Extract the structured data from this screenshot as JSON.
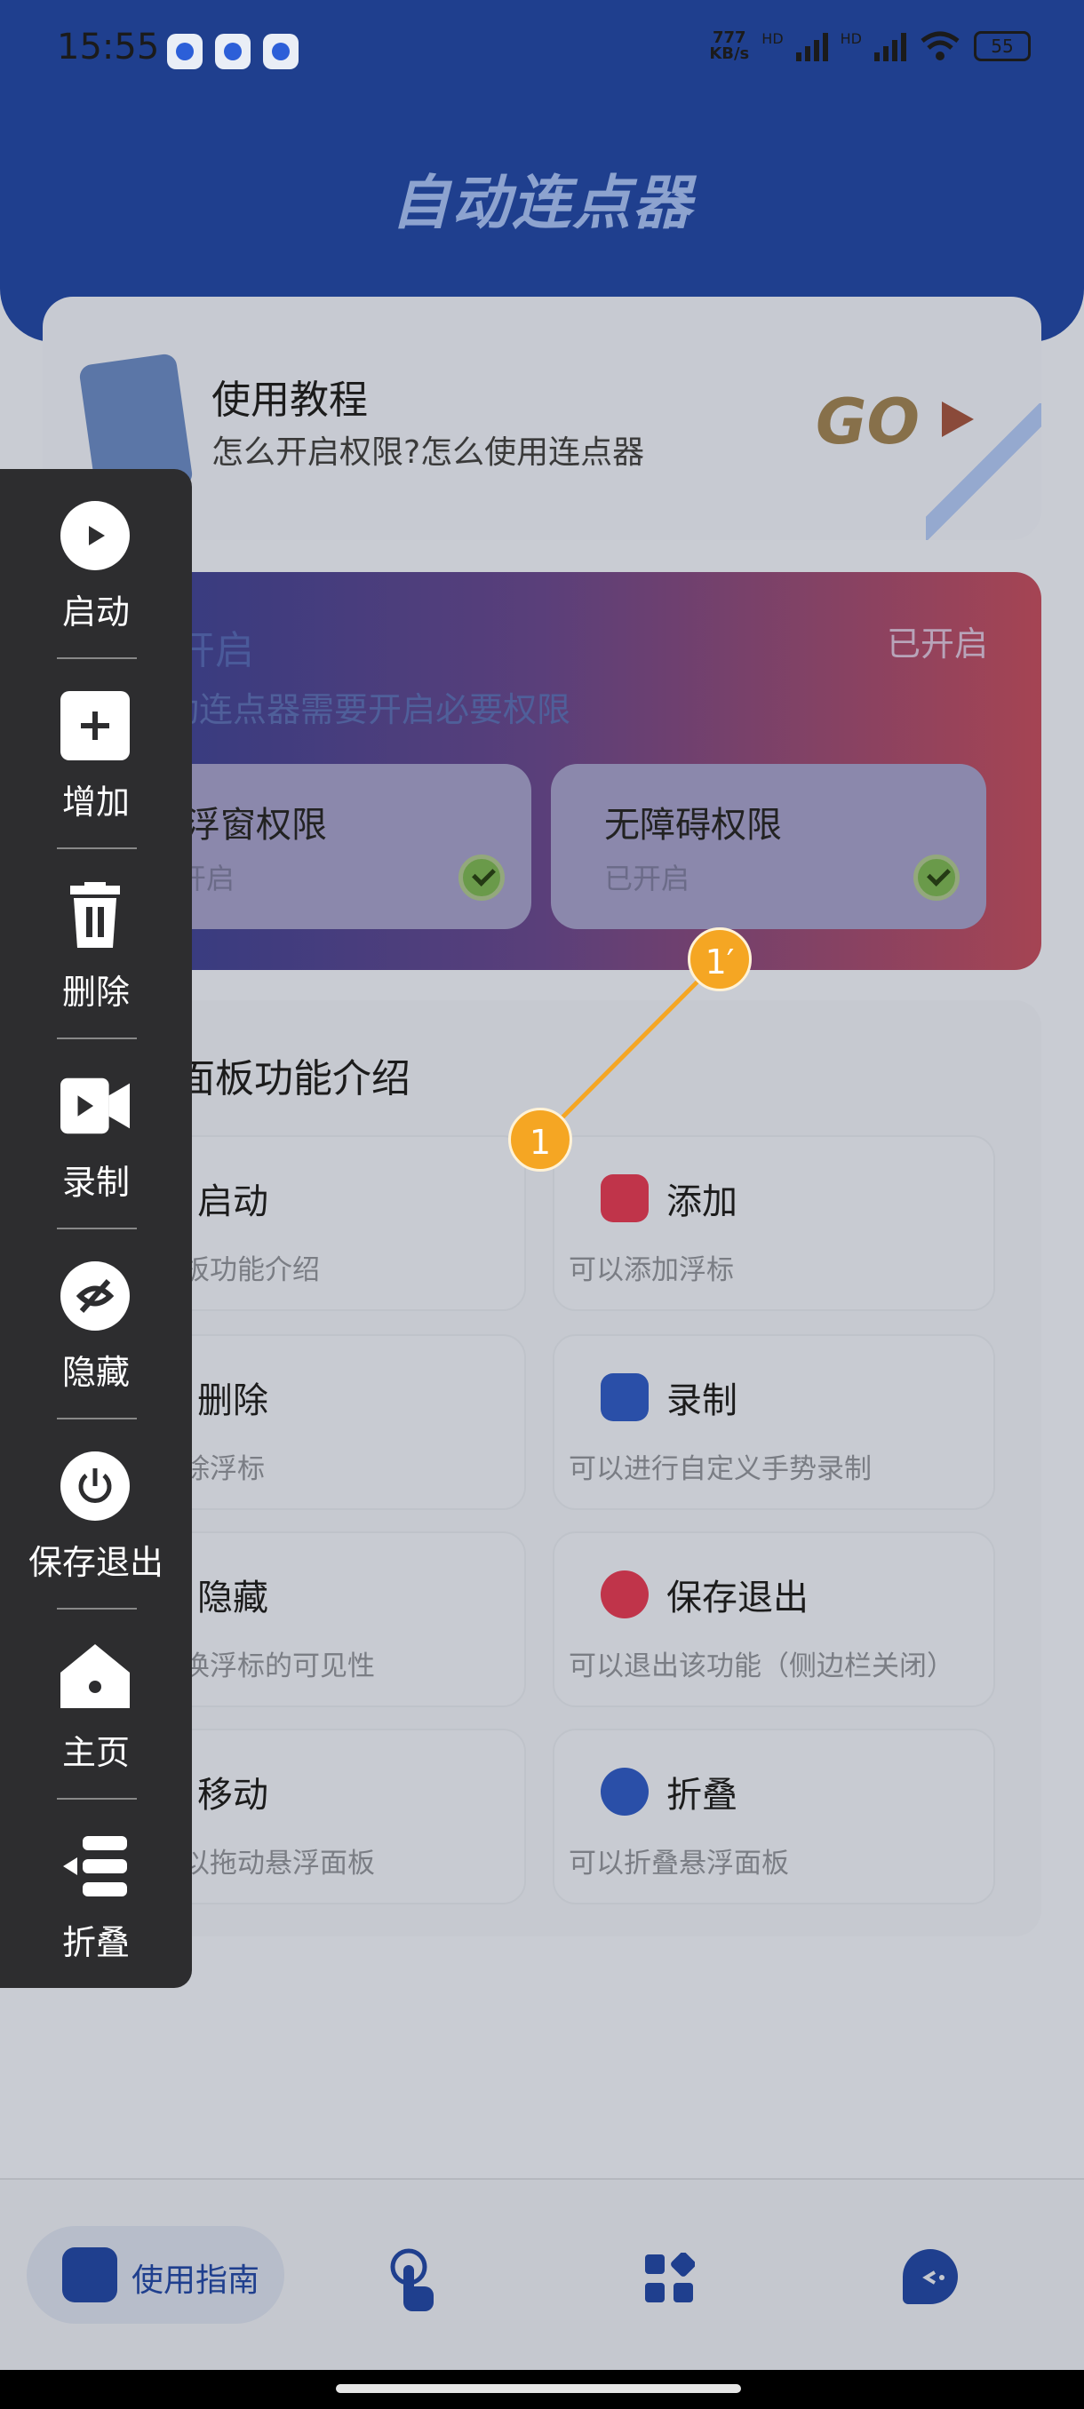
{
  "status_bar": {
    "time": "15:55",
    "net_speed": "777",
    "net_unit": "KB/s",
    "hd1": "HD",
    "hd2": "HD",
    "battery": "55"
  },
  "app_title": "自动连点器",
  "tutorial": {
    "title": "使用教程",
    "subtitle": "怎么开启权限?怎么使用连点器",
    "go": "GO"
  },
  "permissions": {
    "title": "权限开启",
    "status": "已开启",
    "desc": "用自动连点器需要开启必要权限",
    "items": [
      {
        "title": "悬浮窗权限",
        "status": "已开启"
      },
      {
        "title": "无障碍权限",
        "status": "已开启"
      }
    ]
  },
  "intro": {
    "title": "悬浮面板功能介绍",
    "features": [
      {
        "title": "启动",
        "desc": "悬浮面板功能介绍",
        "color": "#2a4fa8"
      },
      {
        "title": "添加",
        "desc": "可以添加浮标",
        "color": "#c0344a"
      },
      {
        "title": "删除",
        "desc": "可以删除浮标",
        "color": "#c0344a"
      },
      {
        "title": "录制",
        "desc": "可以进行自定义手势录制",
        "color": "#2a4fa8"
      },
      {
        "title": "隐藏",
        "desc": "可以切换浮标的可见性",
        "color": "#2a4fa8"
      },
      {
        "title": "保存退出",
        "desc": "可以退出该功能（侧边栏关闭）",
        "color": "#c0344a"
      },
      {
        "title": "移动",
        "desc": "按住可以拖动悬浮面板",
        "color": "#c0344a"
      },
      {
        "title": "折叠",
        "desc": "可以折叠悬浮面板",
        "color": "#2a4fa8"
      }
    ]
  },
  "markers": {
    "start": "1",
    "end": "1′"
  },
  "side_panel": {
    "items": [
      {
        "label": "启动",
        "icon": "play-icon"
      },
      {
        "label": "增加",
        "icon": "plus-icon"
      },
      {
        "label": "删除",
        "icon": "trash-icon"
      },
      {
        "label": "录制",
        "icon": "record-icon"
      },
      {
        "label": "隐藏",
        "icon": "hide-icon"
      },
      {
        "label": "保存退出",
        "icon": "power-icon"
      },
      {
        "label": "主页",
        "icon": "home-icon"
      },
      {
        "label": "折叠",
        "icon": "collapse-icon"
      }
    ]
  },
  "bottom_nav": {
    "guide_label": "使用指南"
  }
}
